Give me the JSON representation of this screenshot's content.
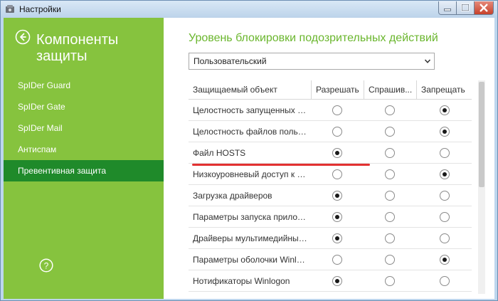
{
  "window": {
    "title": "Настройки"
  },
  "sidebar": {
    "title": "Компоненты защиты",
    "items": [
      {
        "label": "SpIDer Guard",
        "active": false
      },
      {
        "label": "SpIDer Gate",
        "active": false
      },
      {
        "label": "SpIDer Mail",
        "active": false
      },
      {
        "label": "Антиспам",
        "active": false
      },
      {
        "label": "Превентивная защита",
        "active": true
      }
    ],
    "help_label": "?"
  },
  "main": {
    "title": "Уровень блокировки подозрительных действий",
    "level_select": {
      "value": "Пользовательский"
    },
    "table": {
      "headers": [
        "Защищаемый объект",
        "Разрешать",
        "Спрашив...",
        "Запрещать"
      ],
      "rows": [
        {
          "name": "Целостность запущенных пр...",
          "selected": 3
        },
        {
          "name": "Целостность файлов пользов...",
          "selected": 3
        },
        {
          "name": "Файл HOSTS",
          "selected": 1
        },
        {
          "name": "Низкоуровневый доступ к ди...",
          "selected": 3
        },
        {
          "name": "Загрузка драйверов",
          "selected": 1
        },
        {
          "name": "Параметры запуска приложе...",
          "selected": 1
        },
        {
          "name": "Драйверы мультимедийных ...",
          "selected": 1
        },
        {
          "name": "Параметры оболочки Winlog...",
          "selected": 3
        },
        {
          "name": "Нотификаторы Winlogon",
          "selected": 1
        }
      ]
    }
  },
  "colors": {
    "sidebar_bg": "#86c33e",
    "active_item_bg": "#1f8a2a",
    "accent_title": "#6ab62d",
    "annotation_underline": "#e23131"
  }
}
